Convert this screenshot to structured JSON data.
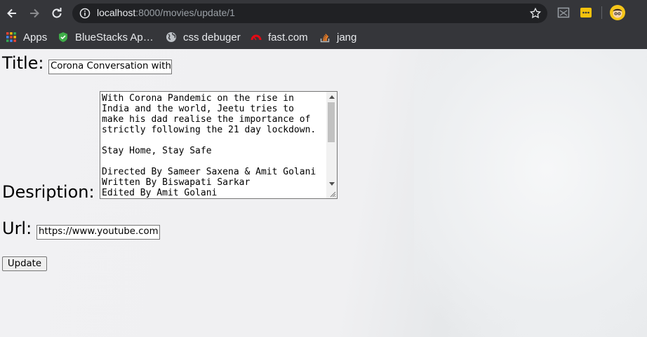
{
  "browser": {
    "url_host": "localhost",
    "url_port_path": ":8000/movies/update/1",
    "bookmarks": [
      {
        "label": "Apps",
        "icon": "apps-grid-icon"
      },
      {
        "label": "BlueStacks Ap…",
        "icon": "bluestacks-icon"
      },
      {
        "label": "css debuger",
        "icon": "globe-icon"
      },
      {
        "label": "fast.com",
        "icon": "fast-speedometer-icon"
      },
      {
        "label": "jang",
        "icon": "stack-overflow-icon"
      }
    ]
  },
  "form": {
    "title_label": "Title:",
    "title_value": "Corona Conversation with",
    "description_label": "Desription:",
    "description_value": "With Corona Pandemic on the rise in\nIndia and the world, Jeetu tries to\nmake his dad realise the importance of\nstrictly following the 21 day lockdown.\n\nStay Home, Stay Safe\n\nDirected By Sameer Saxena & Amit Golani\nWritten By Biswapati Sarkar\nEdited By Amit Golani",
    "url_label": "Url:",
    "url_value": "https://www.youtube.com",
    "submit_label": "Update"
  },
  "colors": {
    "chrome_dark": "#35363a",
    "omnibox_bg": "#202124",
    "page_bg": "#f0f0f2"
  }
}
